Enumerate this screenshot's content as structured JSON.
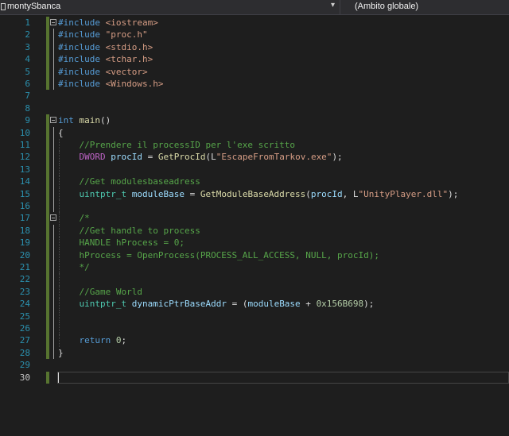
{
  "toolbar": {
    "project_icon": "file-icon",
    "project_name": "montySbanca",
    "dropdown_icon": "dropdown-arrow-icon",
    "scope": "(Ambito globale)"
  },
  "colors": {
    "background": "#1e1e1e",
    "line_number": "#2b91af",
    "comment": "#57a64a",
    "keyword": "#569cd6",
    "string": "#d69d85",
    "macro": "#bd63c5",
    "function": "#dcdcaa",
    "variable": "#9cdcfe",
    "type": "#4ec9b0",
    "number": "#b5cea8",
    "change_bar": "#577430"
  },
  "lines": [
    {
      "n": "1",
      "tokens": [
        {
          "t": "#include ",
          "c": "pp"
        },
        {
          "t": "<iostream>",
          "c": "str"
        }
      ]
    },
    {
      "n": "2",
      "tokens": [
        {
          "t": "#include ",
          "c": "pp"
        },
        {
          "t": "\"proc.h\"",
          "c": "str"
        }
      ]
    },
    {
      "n": "3",
      "tokens": [
        {
          "t": "#include ",
          "c": "pp"
        },
        {
          "t": "<stdio.h>",
          "c": "str"
        }
      ]
    },
    {
      "n": "4",
      "tokens": [
        {
          "t": "#include ",
          "c": "pp"
        },
        {
          "t": "<tchar.h>",
          "c": "str"
        }
      ]
    },
    {
      "n": "5",
      "tokens": [
        {
          "t": "#include ",
          "c": "pp"
        },
        {
          "t": "<vector>",
          "c": "str"
        }
      ]
    },
    {
      "n": "6",
      "tokens": [
        {
          "t": "#include ",
          "c": "pp"
        },
        {
          "t": "<Windows.h>",
          "c": "str"
        }
      ]
    },
    {
      "n": "7",
      "tokens": []
    },
    {
      "n": "8",
      "tokens": []
    },
    {
      "n": "9",
      "tokens": [
        {
          "t": "int",
          "c": "kw"
        },
        {
          "t": " ",
          "c": "p"
        },
        {
          "t": "main",
          "c": "fn"
        },
        {
          "t": "()",
          "c": "p"
        }
      ]
    },
    {
      "n": "10",
      "tokens": [
        {
          "t": "{",
          "c": "p"
        }
      ]
    },
    {
      "n": "11",
      "tokens": [
        {
          "t": "    ",
          "c": "p"
        },
        {
          "t": "//Prendere il processID per l'exe scritto",
          "c": "cm"
        }
      ]
    },
    {
      "n": "12",
      "tokens": [
        {
          "t": "    ",
          "c": "p"
        },
        {
          "t": "DWORD",
          "c": "mac"
        },
        {
          "t": " ",
          "c": "p"
        },
        {
          "t": "procId",
          "c": "var"
        },
        {
          "t": " = ",
          "c": "p"
        },
        {
          "t": "GetProcId",
          "c": "fn"
        },
        {
          "t": "(L",
          "c": "p"
        },
        {
          "t": "\"EscapeFromTarkov.exe\"",
          "c": "str"
        },
        {
          "t": ");",
          "c": "p"
        }
      ]
    },
    {
      "n": "13",
      "tokens": []
    },
    {
      "n": "14",
      "tokens": [
        {
          "t": "    ",
          "c": "p"
        },
        {
          "t": "//Get modulesbaseadress",
          "c": "cm"
        }
      ]
    },
    {
      "n": "15",
      "tokens": [
        {
          "t": "    ",
          "c": "p"
        },
        {
          "t": "uintptr_t",
          "c": "ty"
        },
        {
          "t": " ",
          "c": "p"
        },
        {
          "t": "moduleBase",
          "c": "var"
        },
        {
          "t": " = ",
          "c": "p"
        },
        {
          "t": "GetModuleBaseAddress",
          "c": "fn"
        },
        {
          "t": "(",
          "c": "p"
        },
        {
          "t": "procId",
          "c": "var"
        },
        {
          "t": ", L",
          "c": "p"
        },
        {
          "t": "\"UnityPlayer.dll\"",
          "c": "str"
        },
        {
          "t": ");",
          "c": "p"
        }
      ]
    },
    {
      "n": "16",
      "tokens": []
    },
    {
      "n": "17",
      "tokens": [
        {
          "t": "    ",
          "c": "p"
        },
        {
          "t": "/*",
          "c": "cm"
        }
      ]
    },
    {
      "n": "18",
      "tokens": [
        {
          "t": "    ",
          "c": "p"
        },
        {
          "t": "//Get handle to process",
          "c": "cm"
        }
      ]
    },
    {
      "n": "19",
      "tokens": [
        {
          "t": "    ",
          "c": "p"
        },
        {
          "t": "HANDLE hProcess = 0;",
          "c": "cm"
        }
      ]
    },
    {
      "n": "20",
      "tokens": [
        {
          "t": "    ",
          "c": "p"
        },
        {
          "t": "hProcess = OpenProcess(PROCESS_ALL_ACCESS, NULL, procId);",
          "c": "cm"
        }
      ]
    },
    {
      "n": "21",
      "tokens": [
        {
          "t": "    ",
          "c": "p"
        },
        {
          "t": "*/",
          "c": "cm"
        }
      ]
    },
    {
      "n": "22",
      "tokens": []
    },
    {
      "n": "23",
      "tokens": [
        {
          "t": "    ",
          "c": "p"
        },
        {
          "t": "//Game World",
          "c": "cm"
        }
      ]
    },
    {
      "n": "24",
      "tokens": [
        {
          "t": "    ",
          "c": "p"
        },
        {
          "t": "uintptr_t",
          "c": "ty"
        },
        {
          "t": " ",
          "c": "p"
        },
        {
          "t": "dynamicPtrBaseAddr",
          "c": "var"
        },
        {
          "t": " = (",
          "c": "p"
        },
        {
          "t": "moduleBase",
          "c": "var"
        },
        {
          "t": " + ",
          "c": "p"
        },
        {
          "t": "0x156B698",
          "c": "num"
        },
        {
          "t": ");",
          "c": "p"
        }
      ]
    },
    {
      "n": "25",
      "tokens": []
    },
    {
      "n": "26",
      "tokens": []
    },
    {
      "n": "27",
      "tokens": [
        {
          "t": "    ",
          "c": "p"
        },
        {
          "t": "return",
          "c": "kw"
        },
        {
          "t": " ",
          "c": "p"
        },
        {
          "t": "0",
          "c": "num"
        },
        {
          "t": ";",
          "c": "p"
        }
      ]
    },
    {
      "n": "28",
      "tokens": [
        {
          "t": "}",
          "c": "p"
        }
      ]
    },
    {
      "n": "29",
      "tokens": []
    },
    {
      "n": "30",
      "tokens": []
    }
  ]
}
